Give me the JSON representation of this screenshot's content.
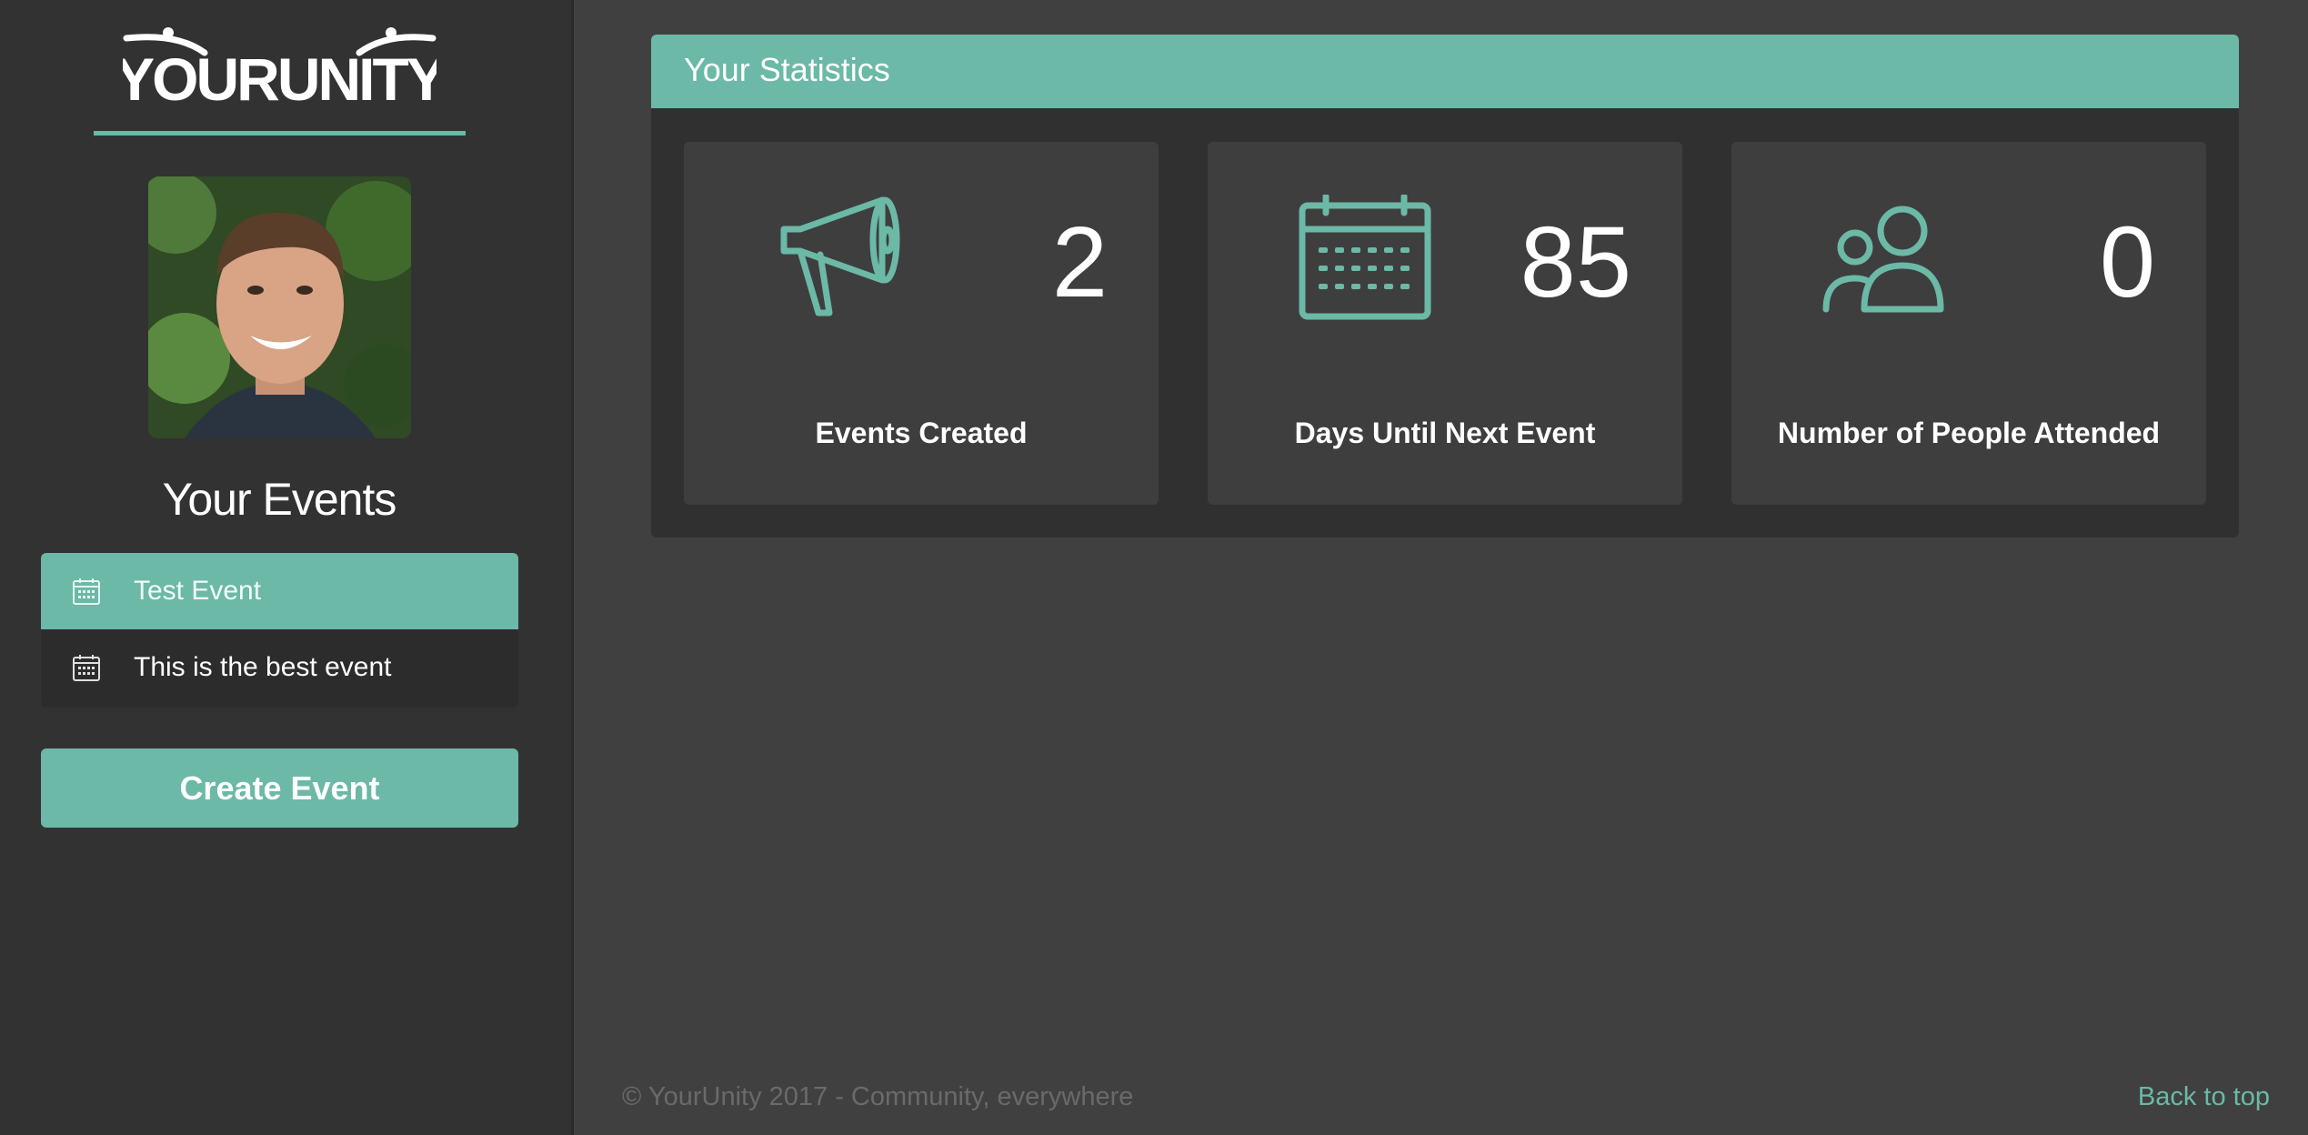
{
  "brand": {
    "logo_text": "YOURUNITY",
    "accent_color": "#6bb9a6"
  },
  "sidebar": {
    "events_heading": "Your Events",
    "events": [
      {
        "label": "Test Event",
        "icon": "calendar-icon",
        "active": true
      },
      {
        "label": "This is the best event",
        "icon": "calendar-icon",
        "active": false
      }
    ],
    "create_button": "Create Event"
  },
  "stats": {
    "title": "Your Statistics",
    "cards": [
      {
        "icon": "megaphone-icon",
        "value": "2",
        "caption": "Events Created"
      },
      {
        "icon": "calendar-icon",
        "value": "85",
        "caption": "Days Until Next Event"
      },
      {
        "icon": "people-icon",
        "value": "0",
        "caption": "Number of People Attended"
      }
    ]
  },
  "footer": {
    "copyright": "© YourUnity 2017 - Community, everywhere",
    "back_to_top": "Back to top"
  }
}
